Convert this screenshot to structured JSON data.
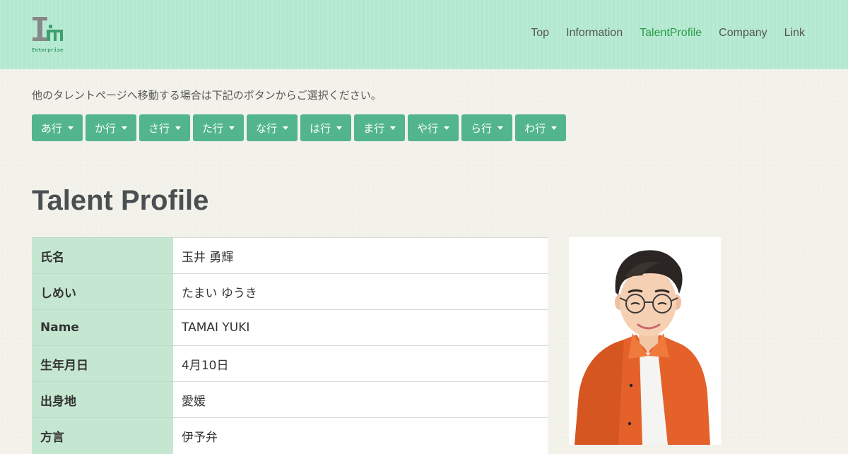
{
  "header": {
    "logo_text": "Enterprise",
    "nav": [
      {
        "label": "Top"
      },
      {
        "label": "Information"
      },
      {
        "label": "TalentProfile",
        "active": true
      },
      {
        "label": "Company"
      },
      {
        "label": "Link"
      }
    ]
  },
  "instruction": "他のタレントページへ移動する場合は下記のボタンからご選択ください。",
  "kana_buttons": [
    "あ行",
    "か行",
    "さ行",
    "た行",
    "な行",
    "は行",
    "ま行",
    "や行",
    "ら行",
    "わ行"
  ],
  "page_title": "Talent Profile",
  "profile": [
    {
      "label": "氏名",
      "value": "玉井 勇輝"
    },
    {
      "label": "しめい",
      "value": "たまい ゆうき"
    },
    {
      "label": "Name",
      "value": "TAMAI YUKI"
    },
    {
      "label": "生年月日",
      "value": "4月10日"
    },
    {
      "label": "出身地",
      "value": "愛媛"
    },
    {
      "label": "方言",
      "value": "伊予弁"
    }
  ],
  "colors": {
    "header_bg": "#b5ead2",
    "accent": "#52b58d",
    "active_link": "#2a9d47",
    "label_bg": "#c5e7d1"
  },
  "icons": {
    "logo": "im-enterprise-logo",
    "dropdown": "caret-down-icon",
    "photo": "talent-photo"
  }
}
